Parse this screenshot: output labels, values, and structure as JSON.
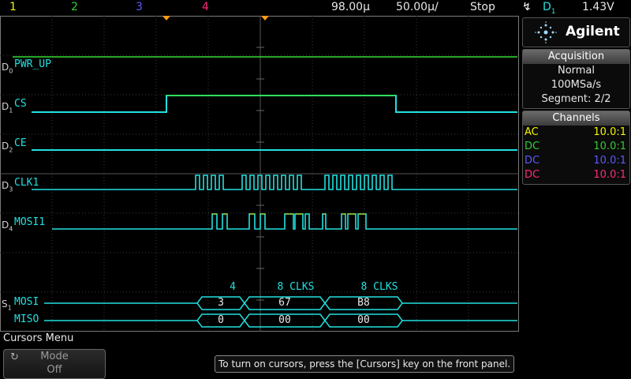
{
  "topbar": {
    "channels": [
      {
        "num": "1",
        "color": "#f5f500"
      },
      {
        "num": "2",
        "color": "#33cc33"
      },
      {
        "num": "3",
        "color": "#5a5aff"
      },
      {
        "num": "4",
        "color": "#ff2a7a"
      }
    ],
    "timebase": "98.00µ",
    "delay": "50.00µ/",
    "run_state": "Stop",
    "trigger_source": "D",
    "trigger_source_sub": "1",
    "trigger_level": "1.43V"
  },
  "brand": {
    "name": "Agilent"
  },
  "acquisition": {
    "title": "Acquisition",
    "mode": "Normal",
    "rate": "100MSa/s",
    "segment": "Segment: 2/2"
  },
  "channels_box": {
    "title": "Channels",
    "rows": [
      {
        "coupling": "AC",
        "ratio": "10.0:1",
        "color": "#f5f500"
      },
      {
        "coupling": "DC",
        "ratio": "10.0:1",
        "color": "#33cc33"
      },
      {
        "coupling": "DC",
        "ratio": "10.0:1",
        "color": "#5a5aff"
      },
      {
        "coupling": "DC",
        "ratio": "10.0:1",
        "color": "#ff2a7a"
      }
    ]
  },
  "digital": [
    {
      "id": "D",
      "sub": "0",
      "name": "PWR_UP"
    },
    {
      "id": "D",
      "sub": "1",
      "name": "CS"
    },
    {
      "id": "D",
      "sub": "2",
      "name": "CE"
    },
    {
      "id": "D",
      "sub": "3",
      "name": "CLK1"
    },
    {
      "id": "D",
      "sub": "4",
      "name": "MOSI1"
    }
  ],
  "serial": {
    "id": "S",
    "sub": "1",
    "headers": [
      "4",
      "8 CLKS",
      "8 CLKS"
    ],
    "rows": [
      {
        "name": "MOSI",
        "values": [
          "3",
          "67",
          "B8"
        ]
      },
      {
        "name": "MISO",
        "values": [
          "0",
          "00",
          "00"
        ]
      }
    ]
  },
  "softkeys": {
    "menu_title": "Cursors Menu",
    "mode_label": "Mode",
    "mode_value": "Off"
  },
  "message": "To turn on cursors, press the [Cursors] key on the front panel."
}
